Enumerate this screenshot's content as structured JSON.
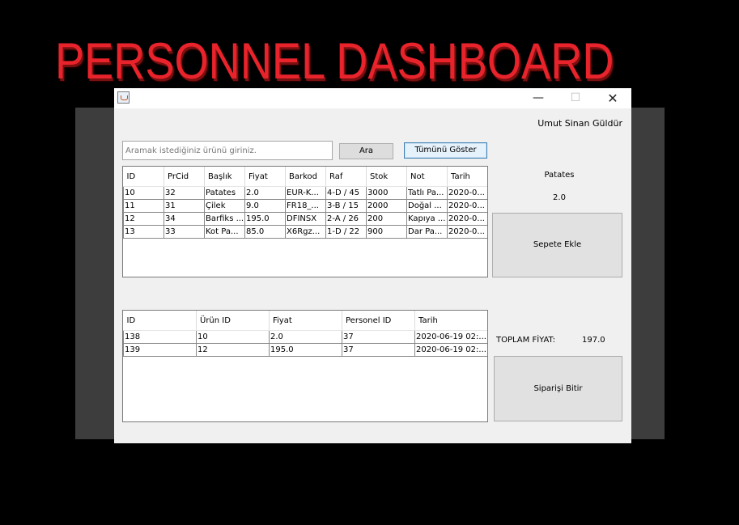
{
  "banner": {
    "title": "PERSONNEL DASHBOARD"
  },
  "window": {
    "icon": "java-cup-icon",
    "controls": {
      "minimize": "—",
      "maximize": "☐",
      "close": "✕"
    }
  },
  "header": {
    "user_name": "Umut Sinan Güldür"
  },
  "search": {
    "placeholder": "Aramak istediğiniz ürünü giriniz.",
    "value": "",
    "search_button": "Ara",
    "show_all_button": "Tümünü Göster"
  },
  "products_table": {
    "columns": [
      "ID",
      "PrCid",
      "Başlık",
      "Fiyat",
      "Barkod",
      "Raf",
      "Stok",
      "Not",
      "Tarih"
    ],
    "rows": [
      [
        "10",
        "32",
        "Patates",
        "2.0",
        "EUR-K...",
        "4-D / 45",
        "3000",
        "Tatlı Pa...",
        "2020-0..."
      ],
      [
        "11",
        "31",
        "Çilek",
        "9.0",
        "FR18_...",
        "3-B / 15",
        "2000",
        "Doğal ...",
        "2020-0..."
      ],
      [
        "12",
        "34",
        "Barfiks ...",
        "195.0",
        "DFINSX",
        "2-A / 26",
        "200",
        "Kapıya ...",
        "2020-0..."
      ],
      [
        "13",
        "33",
        "Kot Pa...",
        "85.0",
        "X6Rgz...",
        "1-D / 22",
        "900",
        "Dar Pa...",
        "2020-0..."
      ]
    ]
  },
  "selected_product": {
    "name": "Patates",
    "price": "2.0",
    "add_to_cart_button": "Sepete Ekle"
  },
  "orders_table": {
    "columns": [
      "ID",
      "Ürün ID",
      "Fiyat",
      "Personel ID",
      "Tarih"
    ],
    "rows": [
      [
        "138",
        "10",
        "2.0",
        "37",
        "2020-06-19 02:..."
      ],
      [
        "139",
        "12",
        "195.0",
        "37",
        "2020-06-19 02:..."
      ]
    ]
  },
  "summary": {
    "total_label": "TOPLAM FİYAT:",
    "total_value": "197.0",
    "finish_order_button": "Siparişi Bitir"
  }
}
